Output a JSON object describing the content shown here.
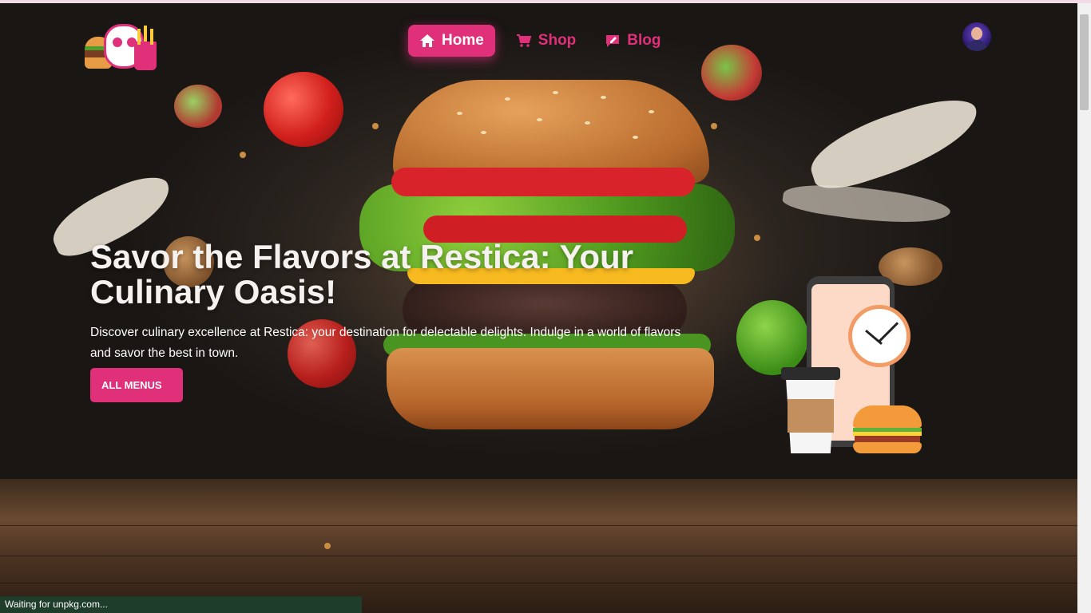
{
  "colors": {
    "accent": "#e0307a",
    "hero_text": "#f4f1ee",
    "status_bg": "#1f3d2b"
  },
  "header": {
    "logo_name": "restica-panda-logo",
    "nav": [
      {
        "label": "Home",
        "icon": "home-icon",
        "active": true
      },
      {
        "label": "Shop",
        "icon": "cart-icon",
        "active": false
      },
      {
        "label": "Blog",
        "icon": "blog-icon",
        "active": false
      }
    ],
    "avatar_icon": "user-avatar"
  },
  "hero": {
    "title": "Savor the Flavors at Restica: Your Culinary Oasis!",
    "description": "Discover culinary excellence at Restica: your destination for delectable delights. Indulge in a world of flavors and savor the best in town.",
    "cta_label": "ALL MENUS"
  },
  "status_bar": {
    "text": "Waiting for unpkg.com..."
  }
}
